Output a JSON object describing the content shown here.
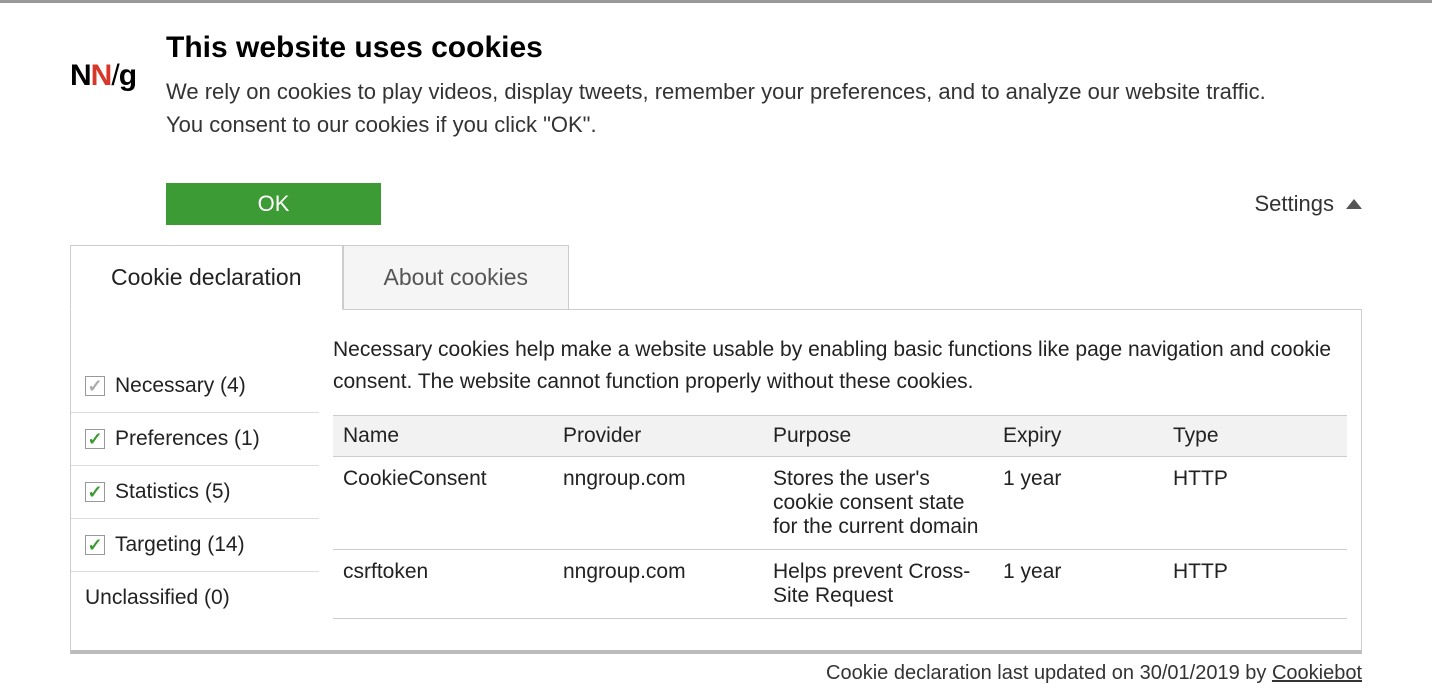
{
  "logo": {
    "n1": "N",
    "n2": "N",
    "slash": "/",
    "g": "g"
  },
  "header": {
    "title": "This website uses cookies",
    "desc": "We rely on cookies to play videos, display tweets, remember your preferences, and to analyze our website traffic. You consent to our cookies if you click \"OK\"."
  },
  "actions": {
    "ok": "OK",
    "settings": "Settings"
  },
  "tabs": {
    "declaration": "Cookie declaration",
    "about": "About cookies"
  },
  "categories": [
    {
      "label": "Necessary (4)",
      "checked": "gray"
    },
    {
      "label": "Preferences (1)",
      "checked": "green"
    },
    {
      "label": "Statistics (5)",
      "checked": "green"
    },
    {
      "label": "Targeting (14)",
      "checked": "green"
    },
    {
      "label": "Unclassified (0)",
      "checked": "none"
    }
  ],
  "detail": {
    "desc": "Necessary cookies help make a website usable by enabling basic functions like page navigation and cookie consent. The website cannot function properly without these cookies."
  },
  "table": {
    "headers": {
      "name": "Name",
      "provider": "Provider",
      "purpose": "Purpose",
      "expiry": "Expiry",
      "type": "Type"
    },
    "rows": [
      {
        "name": "CookieConsent",
        "provider": "nngroup.com",
        "purpose": "Stores the user's cookie consent state for the current domain",
        "expiry": "1 year",
        "type": "HTTP"
      },
      {
        "name": "csrftoken",
        "provider": "nngroup.com",
        "purpose": "Helps prevent Cross-Site Request",
        "expiry": "1 year",
        "type": "HTTP"
      }
    ]
  },
  "footer": {
    "prefix": "Cookie declaration last updated on 30/01/2019 by ",
    "link": "Cookiebot"
  }
}
